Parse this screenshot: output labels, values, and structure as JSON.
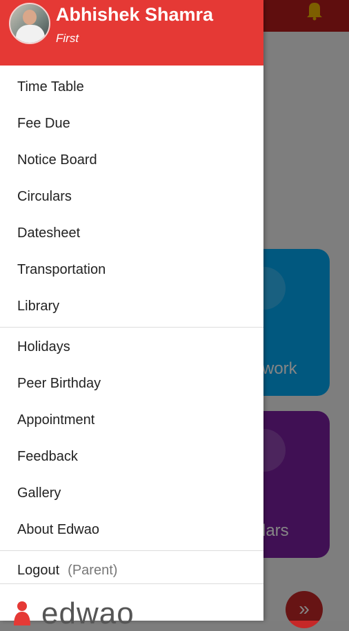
{
  "background": {
    "tile1_label": "work",
    "tile2_label": "lars",
    "next_button_glyph": "»"
  },
  "drawer": {
    "user": {
      "name": "Abhishek Shamra",
      "class": "First"
    },
    "group1": [
      {
        "label": "Time Table"
      },
      {
        "label": "Fee Due"
      },
      {
        "label": "Notice Board"
      },
      {
        "label": "Circulars"
      },
      {
        "label": "Datesheet"
      },
      {
        "label": "Transportation"
      },
      {
        "label": "Library"
      }
    ],
    "group2": [
      {
        "label": "Holidays"
      },
      {
        "label": "Peer Birthday"
      },
      {
        "label": "Appointment"
      },
      {
        "label": "Feedback"
      },
      {
        "label": "Gallery"
      },
      {
        "label": "About Edwao"
      }
    ],
    "logout": {
      "label": "Logout",
      "role": "(Parent)"
    },
    "brand": {
      "logo_text": "edwao"
    }
  },
  "colors": {
    "header_red": "#e53935",
    "topbar_dark_red": "#b71c1c",
    "tile_blue": "#03a9f4",
    "tile_purple": "#7b1fa2"
  }
}
